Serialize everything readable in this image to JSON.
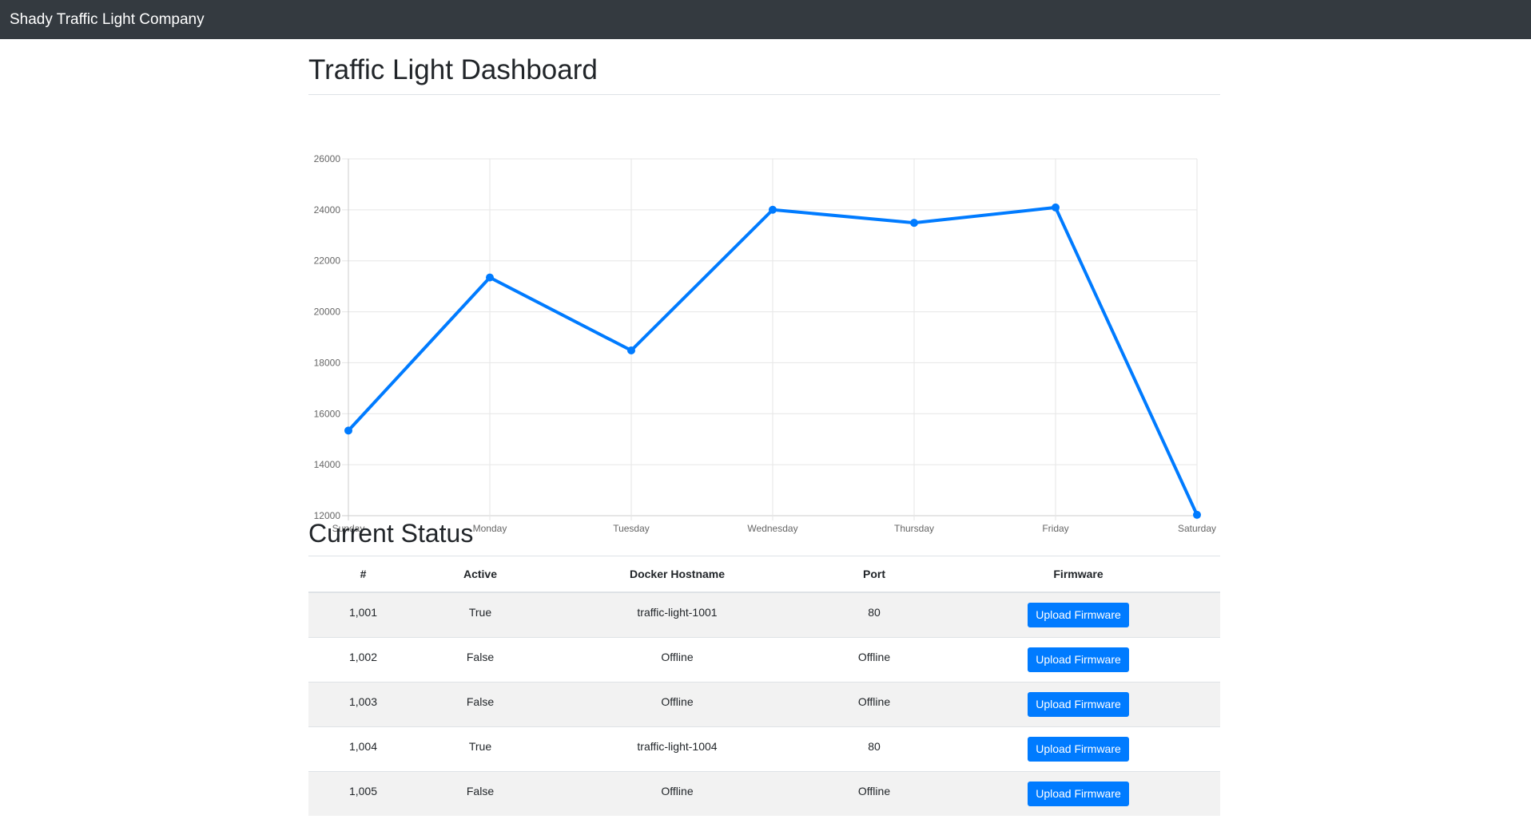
{
  "navbar": {
    "brand": "Shady Traffic Light Company"
  },
  "page": {
    "title": "Traffic Light Dashboard"
  },
  "chart_data": {
    "type": "line",
    "categories": [
      "Sunday",
      "Monday",
      "Tuesday",
      "Wednesday",
      "Thursday",
      "Friday",
      "Saturday"
    ],
    "series": [
      {
        "values": [
          15339,
          21345,
          18483,
          24003,
          23489,
          24092,
          12034
        ],
        "color": "#007bff"
      }
    ],
    "ylim": [
      12000,
      26000
    ],
    "yticks": [
      "26000",
      "24000",
      "22000",
      "20000",
      "18000",
      "16000",
      "14000",
      "12000"
    ],
    "grid": true,
    "legend": "none"
  },
  "status": {
    "title": "Current Status",
    "columns": [
      "#",
      "Active",
      "Docker Hostname",
      "Port",
      "Firmware"
    ],
    "rows": [
      {
        "id": "1,001",
        "active": "True",
        "hostname": "traffic-light-1001",
        "port": "80",
        "button": "Upload Firmware"
      },
      {
        "id": "1,002",
        "active": "False",
        "hostname": "Offline",
        "port": "Offline",
        "button": "Upload Firmware"
      },
      {
        "id": "1,003",
        "active": "False",
        "hostname": "Offline",
        "port": "Offline",
        "button": "Upload Firmware"
      },
      {
        "id": "1,004",
        "active": "True",
        "hostname": "traffic-light-1004",
        "port": "80",
        "button": "Upload Firmware"
      },
      {
        "id": "1,005",
        "active": "False",
        "hostname": "Offline",
        "port": "Offline",
        "button": "Upload Firmware"
      }
    ]
  }
}
